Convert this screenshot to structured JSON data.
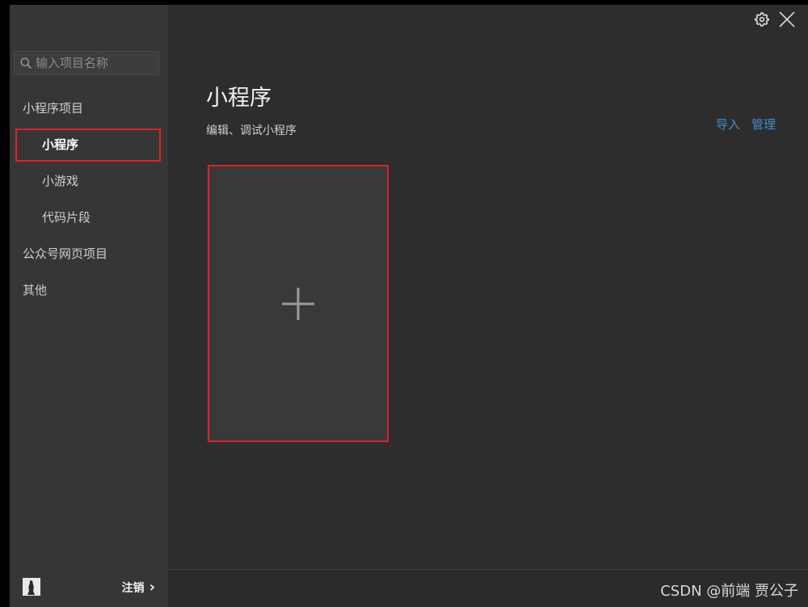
{
  "search": {
    "placeholder": "输入项目名称"
  },
  "sidebar": {
    "items": [
      {
        "label": "小程序项目",
        "level": "group"
      },
      {
        "label": "小程序",
        "level": "child",
        "active": true
      },
      {
        "label": "小游戏",
        "level": "child"
      },
      {
        "label": "代码片段",
        "level": "child"
      },
      {
        "label": "公众号网页项目",
        "level": "group"
      },
      {
        "label": "其他",
        "level": "group"
      }
    ],
    "footer": {
      "logout_label": "注销",
      "logout_chevron": "›"
    }
  },
  "main": {
    "title": "小程序",
    "subtitle": "编辑、调试小程序",
    "actions": {
      "import_label": "导入",
      "manage_label": "管理"
    }
  },
  "watermark": "CSDN @前端 贾公子",
  "icons": {
    "search": "search-icon",
    "settings": "gear-icon",
    "close": "close-icon",
    "plus": "plus-icon",
    "avatar": "avatar"
  },
  "colors": {
    "accent_link": "#3f8fd0",
    "highlight": "#e0202a",
    "sidebar_bg": "#363636",
    "main_bg": "#2d2d2d"
  }
}
